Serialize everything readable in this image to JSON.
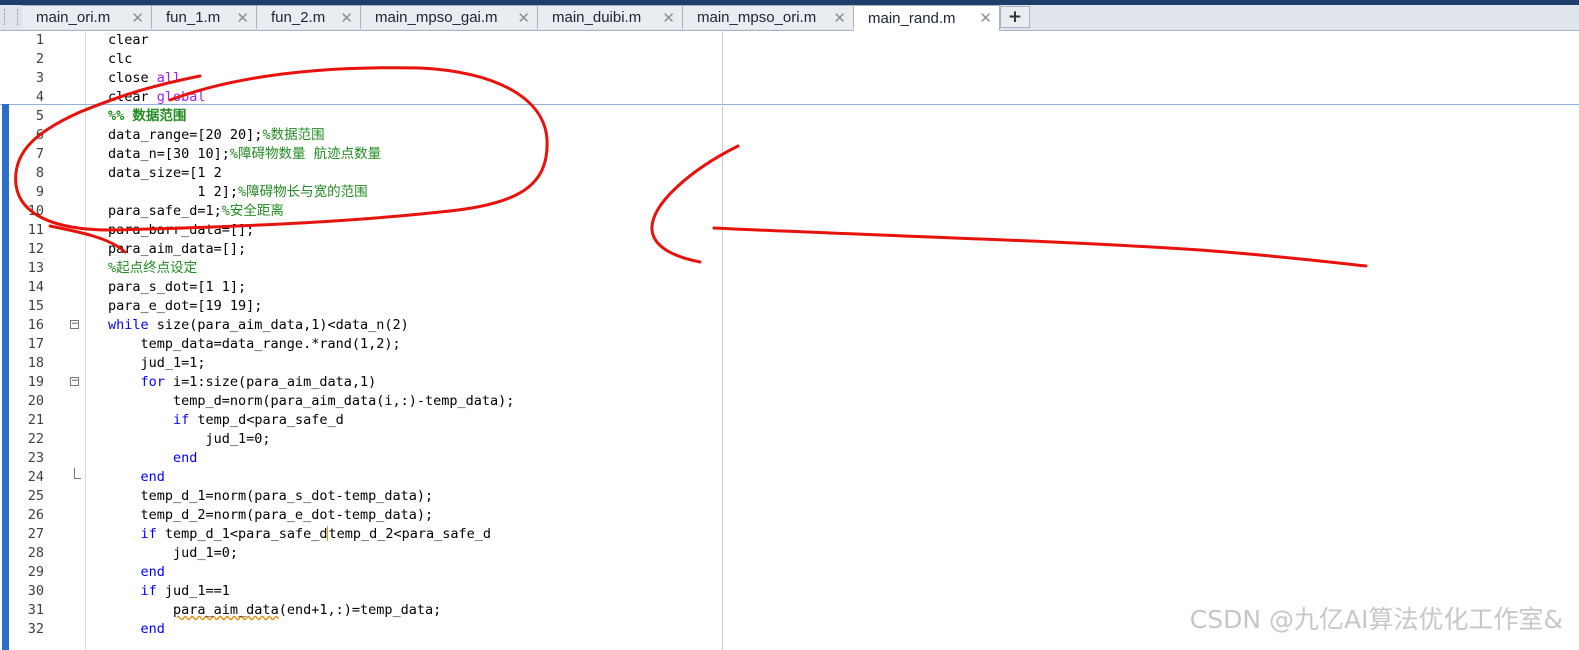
{
  "tabs": [
    {
      "label": "main_ori.m",
      "active": false
    },
    {
      "label": "fun_1.m",
      "active": false
    },
    {
      "label": "fun_2.m",
      "active": false
    },
    {
      "label": "main_mpso_gai.m",
      "active": false
    },
    {
      "label": "main_duibi.m",
      "active": false
    },
    {
      "label": "main_mpso_ori.m",
      "active": false
    },
    {
      "label": "main_rand.m",
      "active": true
    }
  ],
  "icons": {
    "close": "close-icon",
    "add": "plus-icon",
    "handle": "tab-strip-handle-icon"
  },
  "tab_close_glyph": "✕",
  "add_glyph": "+",
  "colors": {
    "keyword": "#0000ff",
    "string": "#a020f0",
    "comment": "#228b22",
    "annotation": "#e8120c"
  },
  "lines": [
    {
      "n": "1",
      "segs": [
        [
          "t",
          "clear"
        ]
      ]
    },
    {
      "n": "2",
      "segs": [
        [
          "t",
          "clc"
        ]
      ]
    },
    {
      "n": "3",
      "segs": [
        [
          "t",
          "close "
        ],
        [
          "s",
          "all"
        ]
      ]
    },
    {
      "n": "4",
      "segs": [
        [
          "t",
          "clear "
        ],
        [
          "s",
          "global"
        ]
      ]
    },
    {
      "n": "5",
      "segs": [
        [
          "h",
          "%% 数据范围"
        ]
      ]
    },
    {
      "n": "6",
      "segs": [
        [
          "t",
          "data_range=[20 20];"
        ],
        [
          "c",
          "%数据范围"
        ]
      ]
    },
    {
      "n": "7",
      "segs": [
        [
          "t",
          "data_n=[30 10];"
        ],
        [
          "c",
          "%障碍物数量 航迹点数量"
        ]
      ]
    },
    {
      "n": "8",
      "segs": [
        [
          "t",
          "data_size=[1 2"
        ]
      ]
    },
    {
      "n": "9",
      "segs": [
        [
          "t",
          "           1 2];"
        ],
        [
          "c",
          "%障碍物长与宽的范围"
        ]
      ]
    },
    {
      "n": "10",
      "segs": [
        [
          "t",
          "para_safe_d=1;"
        ],
        [
          "c",
          "%安全距离"
        ]
      ]
    },
    {
      "n": "11",
      "segs": [
        [
          "t",
          "para_barr_data=[];"
        ]
      ]
    },
    {
      "n": "12",
      "segs": [
        [
          "t",
          "para_aim_data=[];"
        ]
      ]
    },
    {
      "n": "13",
      "segs": [
        [
          "c",
          "%起点终点设定"
        ]
      ]
    },
    {
      "n": "14",
      "segs": [
        [
          "t",
          "para_s_dot=[1 1];"
        ]
      ]
    },
    {
      "n": "15",
      "segs": [
        [
          "t",
          "para_e_dot=[19 19];"
        ]
      ]
    },
    {
      "n": "16",
      "fold": "open",
      "segs": [
        [
          "k",
          "while"
        ],
        [
          "t",
          " size(para_aim_data,1)<data_n(2)"
        ]
      ]
    },
    {
      "n": "17",
      "segs": [
        [
          "t",
          "    temp_data=data_range.*rand(1,2);"
        ]
      ]
    },
    {
      "n": "18",
      "segs": [
        [
          "t",
          "    jud_1=1;"
        ]
      ]
    },
    {
      "n": "19",
      "fold": "open",
      "segs": [
        [
          "t",
          "    "
        ],
        [
          "k",
          "for"
        ],
        [
          "t",
          " i=1:size(para_aim_data,1)"
        ]
      ]
    },
    {
      "n": "20",
      "segs": [
        [
          "t",
          "        temp_d=norm(para_aim_data(i,:)-temp_data);"
        ]
      ]
    },
    {
      "n": "21",
      "segs": [
        [
          "t",
          "        "
        ],
        [
          "k",
          "if"
        ],
        [
          "t",
          " temp_d<para_safe_d"
        ]
      ]
    },
    {
      "n": "22",
      "segs": [
        [
          "t",
          "            jud_1=0;"
        ]
      ]
    },
    {
      "n": "23",
      "segs": [
        [
          "t",
          "        "
        ],
        [
          "k",
          "end"
        ]
      ]
    },
    {
      "n": "24",
      "fold": "end",
      "segs": [
        [
          "t",
          "    "
        ],
        [
          "k",
          "end"
        ]
      ]
    },
    {
      "n": "25",
      "segs": [
        [
          "t",
          "    temp_d_1=norm(para_s_dot-temp_data);"
        ]
      ]
    },
    {
      "n": "26",
      "segs": [
        [
          "t",
          "    temp_d_2=norm(para_e_dot-temp_data);"
        ]
      ]
    },
    {
      "n": "27",
      "segs": [
        [
          "t",
          "    "
        ],
        [
          "k",
          "if"
        ],
        [
          "t",
          " temp_d_1<para_safe_d"
        ],
        [
          "cur",
          ""
        ],
        [
          "t",
          "temp_d_2<para_safe_d"
        ]
      ]
    },
    {
      "n": "28",
      "segs": [
        [
          "t",
          "        jud_1=0;"
        ]
      ]
    },
    {
      "n": "29",
      "segs": [
        [
          "t",
          "    "
        ],
        [
          "k",
          "end"
        ]
      ]
    },
    {
      "n": "30",
      "segs": [
        [
          "t",
          "    "
        ],
        [
          "k",
          "if"
        ],
        [
          "t",
          " jud_1==1"
        ]
      ]
    },
    {
      "n": "31",
      "segs": [
        [
          "t",
          "        "
        ],
        [
          "w",
          "para_aim_data"
        ],
        [
          "t",
          "(end+1,:)=temp_data;"
        ]
      ]
    },
    {
      "n": "32",
      "segs": [
        [
          "t",
          "    "
        ],
        [
          "k",
          "end"
        ]
      ]
    }
  ],
  "watermark": "CSDN @九亿AI算法优化工作室&"
}
